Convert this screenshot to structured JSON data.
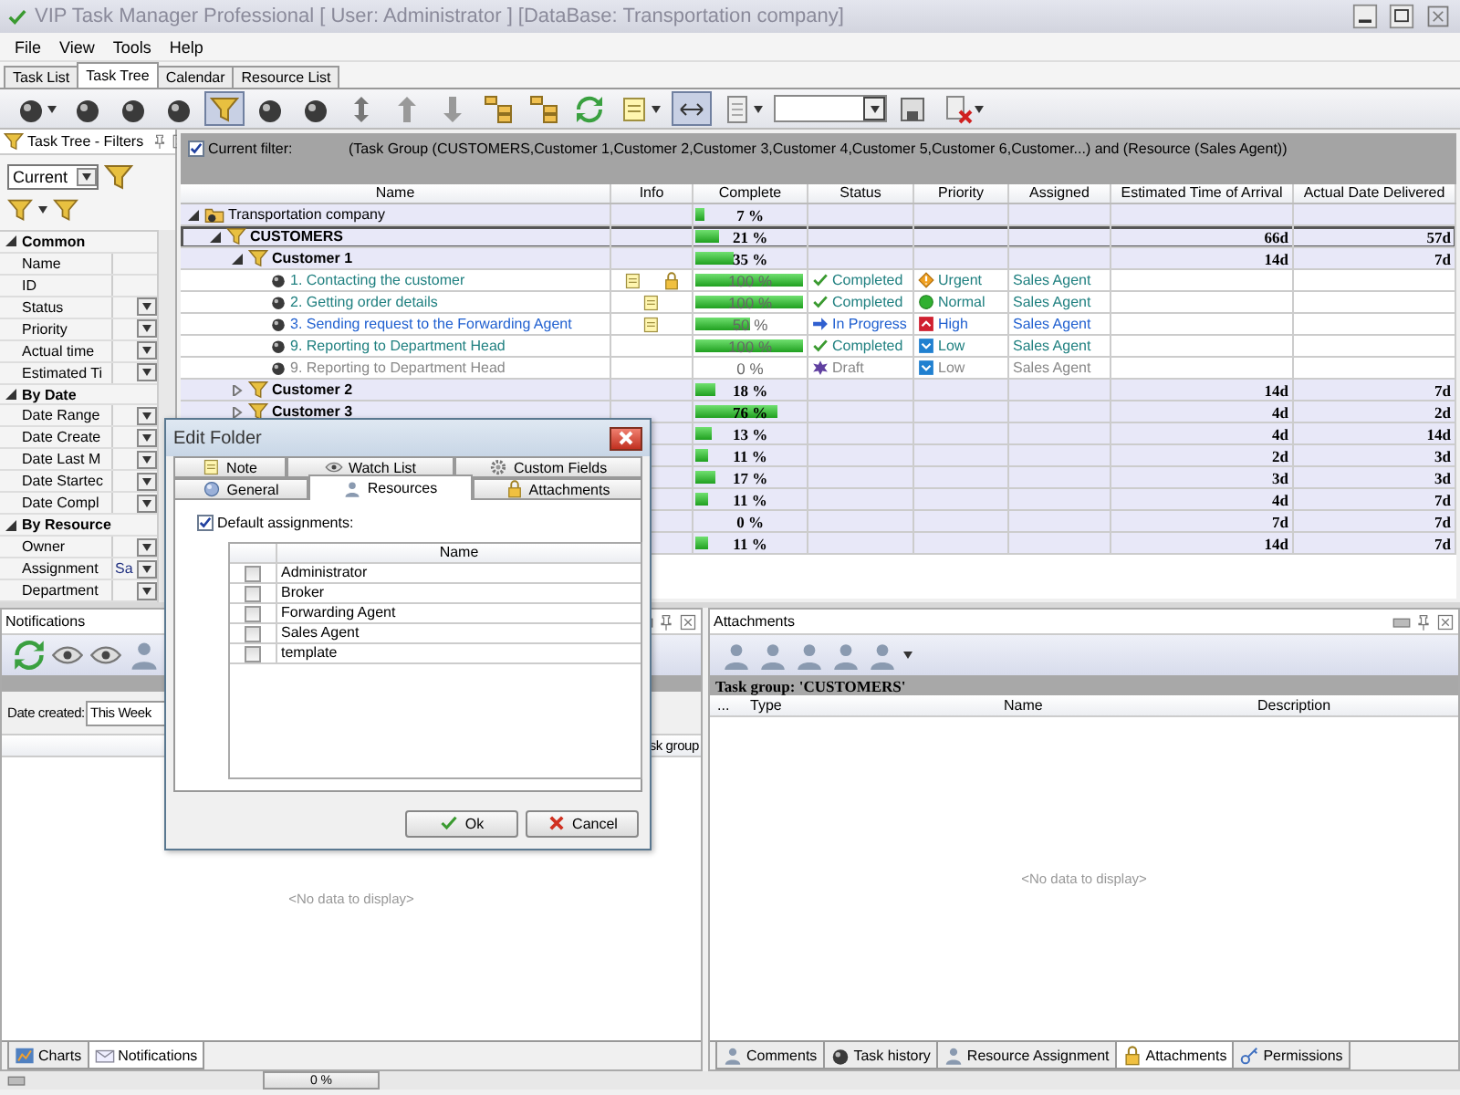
{
  "window": {
    "title": "VIP Task Manager Professional [ User: Administrator ] [DataBase: Transportation company]"
  },
  "menu": [
    "File",
    "View",
    "Tools",
    "Help"
  ],
  "tabs": [
    {
      "label": "Task List",
      "selected": false
    },
    {
      "label": "Task Tree",
      "selected": true
    },
    {
      "label": "Calendar",
      "selected": false
    },
    {
      "label": "Resource List",
      "selected": false
    }
  ],
  "toolbar": [
    {
      "kind": "ball",
      "caret": true,
      "selected": false
    },
    {
      "kind": "ball",
      "caret": false,
      "selected": false
    },
    {
      "kind": "ball",
      "caret": false,
      "selected": false
    },
    {
      "kind": "ball",
      "caret": false,
      "selected": false
    },
    {
      "kind": "funnel",
      "caret": false,
      "selected": true
    },
    {
      "kind": "ball",
      "caret": false,
      "selected": false
    },
    {
      "kind": "ball",
      "caret": false,
      "selected": false
    },
    {
      "kind": "updown",
      "caret": false,
      "selected": false
    },
    {
      "kind": "up",
      "caret": false,
      "selected": false
    },
    {
      "kind": "down",
      "caret": false,
      "selected": false
    },
    {
      "kind": "tree",
      "caret": false,
      "selected": false
    },
    {
      "kind": "tree",
      "caret": false,
      "selected": false
    },
    {
      "kind": "refresh",
      "caret": false,
      "selected": false
    },
    {
      "kind": "note",
      "caret": true,
      "selected": false
    },
    {
      "kind": "width",
      "caret": false,
      "selected": true
    },
    {
      "kind": "doc",
      "caret": true,
      "selected": false
    },
    {
      "kind": "combo"
    },
    {
      "kind": "save",
      "caret": false,
      "selected": false
    },
    {
      "kind": "del",
      "caret": true,
      "selected": false
    }
  ],
  "filters": {
    "title": "Task Tree - Filters",
    "preset": "Current",
    "sections": [
      {
        "title": "Common",
        "expanded": true,
        "items": [
          {
            "label": "Name",
            "dropdown": false
          },
          {
            "label": "ID",
            "dropdown": false
          },
          {
            "label": "Status",
            "dropdown": true
          },
          {
            "label": "Priority",
            "dropdown": true
          },
          {
            "label": "Actual time",
            "dropdown": true
          },
          {
            "label": "Estimated Ti",
            "dropdown": true
          }
        ]
      },
      {
        "title": "By Date",
        "expanded": true,
        "items": [
          {
            "label": "Date Range",
            "dropdown": true
          },
          {
            "label": "Date Create",
            "dropdown": true
          },
          {
            "label": "Date Last M",
            "dropdown": true
          },
          {
            "label": "Date Startec",
            "dropdown": true
          },
          {
            "label": "Date Compl",
            "dropdown": true
          }
        ]
      },
      {
        "title": "By Resource",
        "expanded": true,
        "items": [
          {
            "label": "Owner",
            "dropdown": true
          },
          {
            "label": "Assignment",
            "value": "Sa",
            "dropdown": true
          },
          {
            "label": "Department",
            "dropdown": true
          }
        ]
      }
    ]
  },
  "filter_bar": {
    "checked": true,
    "label": "Current filter:",
    "text": "(Task Group  (CUSTOMERS,Customer 1,Customer 2,Customer 3,Customer 4,Customer 5,Customer 6,Customer...) and (Resource  (Sales Agent))"
  },
  "grid": {
    "columns": [
      "Name",
      "Info",
      "Complete",
      "Status",
      "Priority",
      "Assigned",
      "Estimated Time of Arrival",
      "Actual Date Delivered"
    ],
    "rows": [
      {
        "kind": "root",
        "name": "Transportation company",
        "complete": "7 %",
        "level": 0.07,
        "selected": false,
        "expanded": true,
        "children": [
          {
            "kind": "group",
            "name": "CUSTOMERS",
            "complete": "21 %",
            "level": 0.21,
            "eta": "66d",
            "delivered": "57d",
            "selected": true,
            "expanded": true,
            "children": [
              {
                "kind": "group",
                "name": "Customer 1",
                "complete": "35 %",
                "level": 0.35,
                "eta": "14d",
                "delivered": "7d",
                "selected": false,
                "expanded": true,
                "children": [
                  {
                    "kind": "task",
                    "name": "1. Contacting the customer",
                    "note": true,
                    "locked": true,
                    "complete": "100 %",
                    "level": 1,
                    "status": {
                      "label": "Completed",
                      "kind": "completed"
                    },
                    "priority": {
                      "label": "Urgent",
                      "kind": "urgent"
                    },
                    "assigned": "Sales Agent",
                    "selected": false
                  },
                  {
                    "kind": "task",
                    "name": "2. Getting order details",
                    "note": true,
                    "locked": false,
                    "complete": "100 %",
                    "level": 1,
                    "status": {
                      "label": "Completed",
                      "kind": "completed"
                    },
                    "priority": {
                      "label": "Normal",
                      "kind": "normal"
                    },
                    "assigned": "Sales Agent",
                    "selected": false
                  },
                  {
                    "kind": "task",
                    "name": "3. Sending request to the Forwarding Agent",
                    "note": true,
                    "locked": false,
                    "complete": "50 %",
                    "level": 0.5,
                    "status": {
                      "label": "In Progress",
                      "kind": "progress"
                    },
                    "priority": {
                      "label": "High",
                      "kind": "high"
                    },
                    "assigned": "Sales Agent",
                    "selected": false
                  },
                  {
                    "kind": "task",
                    "name": "9. Reporting to Department Head",
                    "note": false,
                    "locked": false,
                    "complete": "100 %",
                    "level": 1,
                    "status": {
                      "label": "Completed",
                      "kind": "completed"
                    },
                    "priority": {
                      "label": "Low",
                      "kind": "low"
                    },
                    "assigned": "Sales Agent",
                    "selected": false
                  },
                  {
                    "kind": "task",
                    "name": "9. Reporting to Department Head",
                    "note": false,
                    "locked": false,
                    "complete": "0 %",
                    "level": 0,
                    "status": {
                      "label": "Draft",
                      "kind": "draft"
                    },
                    "priority": {
                      "label": "Low",
                      "kind": "low"
                    },
                    "assigned": "Sales Agent",
                    "selected": false
                  }
                ]
              },
              {
                "kind": "group",
                "name": "Customer 2",
                "complete": "18 %",
                "level": 0.18,
                "eta": "14d",
                "delivered": "7d",
                "selected": false,
                "expanded": false
              },
              {
                "kind": "group",
                "name": "Customer 3",
                "complete": "76 %",
                "level": 0.76,
                "eta": "4d",
                "delivered": "2d",
                "selected": false,
                "expanded": false
              },
              {
                "kind": "group",
                "complete": "13 %",
                "level": 0.13,
                "eta": "4d",
                "delivered": "14d",
                "selected": false
              },
              {
                "kind": "group",
                "complete": "11 %",
                "level": 0.11,
                "eta": "2d",
                "delivered": "3d",
                "selected": false
              },
              {
                "kind": "group",
                "complete": "17 %",
                "level": 0.17,
                "eta": "3d",
                "delivered": "3d",
                "selected": false
              },
              {
                "kind": "group",
                "complete": "11 %",
                "level": 0.11,
                "eta": "4d",
                "delivered": "7d",
                "selected": false
              },
              {
                "kind": "group",
                "complete": "0 %",
                "level": 0,
                "eta": "7d",
                "delivered": "7d",
                "selected": false
              },
              {
                "kind": "group",
                "complete": "11 %",
                "level": 0.11,
                "eta": "14d",
                "delivered": "7d",
                "selected": false
              }
            ]
          }
        ]
      }
    ]
  },
  "notifications": {
    "title": "Notifications",
    "date_label": "Date created:",
    "date_value": "This Week",
    "column": "sk group",
    "empty": "<No data to display>"
  },
  "attachments": {
    "title": "Attachments",
    "group": "Task group: 'CUSTOMERS'",
    "columns": [
      "...",
      "Type",
      "Name",
      "Description"
    ],
    "empty": "<No data to display>"
  },
  "left_tabs": [
    {
      "label": "Charts",
      "selected": false
    },
    {
      "label": "Notifications",
      "selected": true
    }
  ],
  "right_tabs": [
    {
      "label": "Comments",
      "selected": false
    },
    {
      "label": "Task history",
      "selected": false
    },
    {
      "label": "Resource Assignment",
      "selected": false
    },
    {
      "label": "Attachments",
      "selected": true
    },
    {
      "label": "Permissions",
      "selected": false
    }
  ],
  "status_bar": {
    "progress": "0 %",
    "level": 0
  },
  "dialog": {
    "title": "Edit Folder",
    "tab_rows": [
      [
        {
          "label": "Note",
          "selected": false
        },
        {
          "label": "Watch List",
          "selected": false
        },
        {
          "label": "Custom Fields",
          "selected": false
        }
      ],
      [
        {
          "label": "General",
          "selected": false
        },
        {
          "label": "Resources",
          "selected": true
        },
        {
          "label": "Attachments",
          "selected": false
        }
      ]
    ],
    "default_label": "Default assignments:",
    "default_checked": true,
    "column": "Name",
    "resources": [
      {
        "name": "Administrator",
        "checked": false
      },
      {
        "name": "Broker",
        "checked": false
      },
      {
        "name": "Forwarding Agent",
        "checked": false
      },
      {
        "name": "Sales Agent",
        "checked": false
      },
      {
        "name": "template",
        "checked": false
      }
    ],
    "buttons": [
      {
        "label": "Ok",
        "kind": "ok"
      },
      {
        "label": "Cancel",
        "kind": "cancel"
      }
    ]
  }
}
